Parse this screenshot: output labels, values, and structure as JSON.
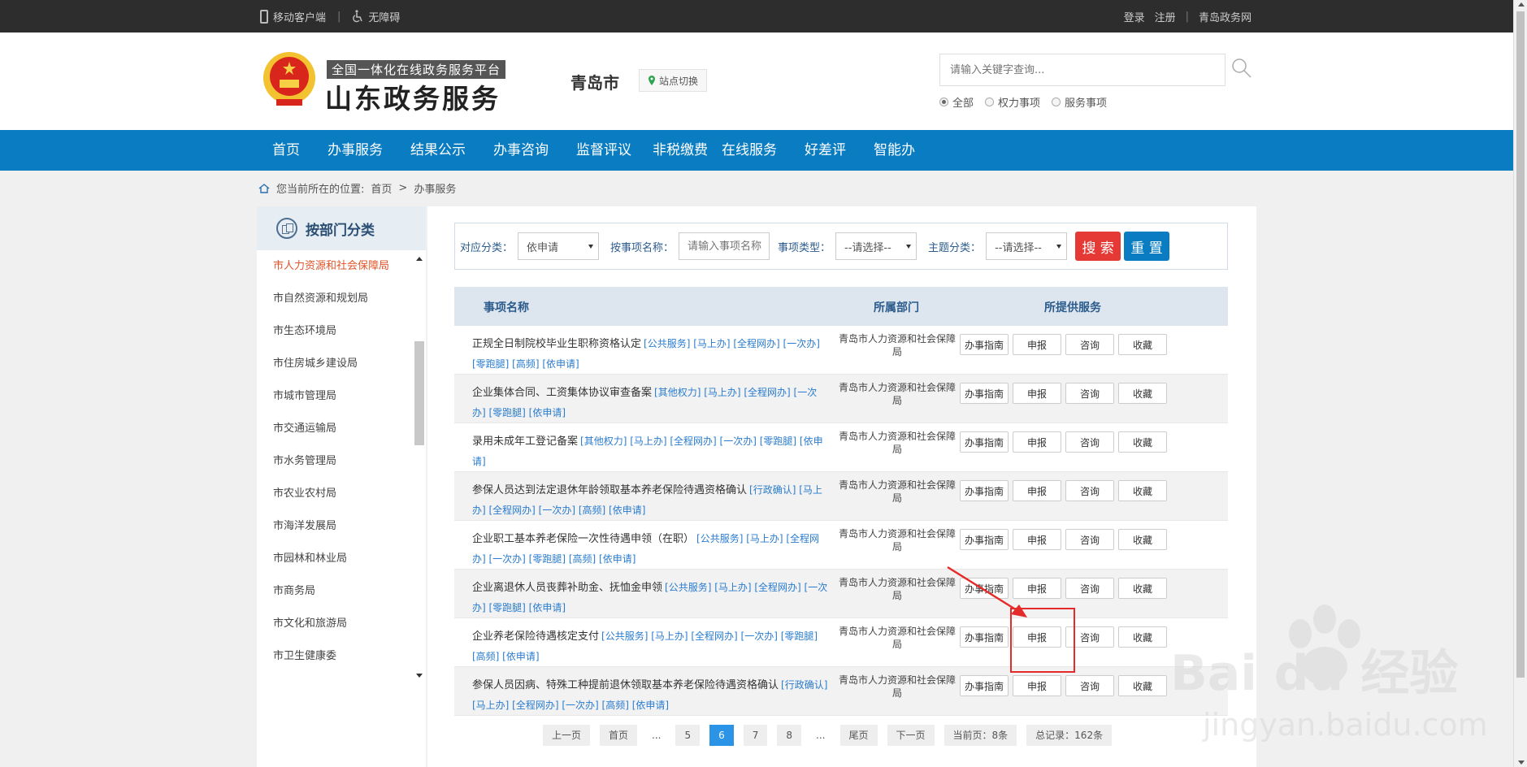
{
  "topbar": {
    "mobile_label": "移动客户端",
    "accessibility_label": "无障碍",
    "login_label": "登录",
    "register_label": "注册",
    "site_label": "青岛政务网"
  },
  "header": {
    "brand_sub": "全国一体化在线政务服务平台",
    "brand_main": "山东政务服务",
    "city": "青岛市",
    "site_switch": "站点切换",
    "search_placeholder": "请输入关键字查询...",
    "radio_all": "全部",
    "radio_power": "权力事项",
    "radio_service": "服务事项"
  },
  "nav": [
    "首页",
    "办事服务",
    "结果公示",
    "办事咨询",
    "监督评议",
    "非税缴费",
    "在线服务",
    "好差评",
    "智能办"
  ],
  "breadcrumb": {
    "prefix": "您当前所在的位置:",
    "home": "首页",
    "sep": ">",
    "current": "办事服务"
  },
  "sidebar": {
    "title": "按部门分类",
    "items": [
      "市人力资源和社会保障局",
      "市自然资源和规划局",
      "市生态环境局",
      "市住房城乡建设局",
      "市城市管理局",
      "市交通运输局",
      "市水务管理局",
      "市农业农村局",
      "市海洋发展局",
      "市园林和林业局",
      "市商务局",
      "市文化和旅游局",
      "市卫生健康委"
    ]
  },
  "filter": {
    "category_label": "对应分类：",
    "category_value": "依申请",
    "name_label": "按事项名称：",
    "name_placeholder": "请输入事项名称",
    "type_label": "事项类型：",
    "type_value": "--请选择--",
    "theme_label": "主题分类：",
    "theme_value": "--请选择--",
    "search_btn": "搜 索",
    "reset_btn": "重 置"
  },
  "table": {
    "headers": [
      "事项名称",
      "所属部门",
      "所提供服务"
    ],
    "actions": [
      "办事指南",
      "申报",
      "咨询",
      "收藏"
    ],
    "rows": [
      {
        "name": "正规全日制院校毕业生职称资格认定",
        "tags": "[公共服务] [马上办] [全程网办] [一次办] [零跑腿] [高频] [依申请]",
        "dept": "青岛市人力资源和社会保障局"
      },
      {
        "name": "企业集体合同、工资集体协议审查备案",
        "tags": "[其他权力] [马上办] [全程网办] [一次办] [零跑腿] [依申请]",
        "dept": "青岛市人力资源和社会保障局"
      },
      {
        "name": "录用未成年工登记备案",
        "tags": "[其他权力] [马上办] [全程网办] [一次办] [零跑腿] [依申请]",
        "dept": "青岛市人力资源和社会保障局"
      },
      {
        "name": "参保人员达到法定退休年龄领取基本养老保险待遇资格确认",
        "tags": "[行政确认] [马上办] [全程网办] [一次办] [高频] [依申请]",
        "dept": "青岛市人力资源和社会保障局"
      },
      {
        "name": "企业职工基本养老保险一次性待遇申领（在职）",
        "tags": "[公共服务] [马上办] [全程网办] [一次办] [零跑腿] [高频] [依申请]",
        "dept": "青岛市人力资源和社会保障局"
      },
      {
        "name": "企业离退休人员丧葬补助金、抚恤金申领",
        "tags": "[公共服务] [马上办] [全程网办] [一次办] [零跑腿] [依申请]",
        "dept": "青岛市人力资源和社会保障局"
      },
      {
        "name": "企业养老保险待遇核定支付",
        "tags": "[公共服务] [马上办] [全程网办] [一次办] [零跑腿] [高频] [依申请]",
        "dept": "青岛市人力资源和社会保障局"
      },
      {
        "name": "参保人员因病、特殊工种提前退休领取基本养老保险待遇资格确认",
        "tags": "[行政确认] [马上办] [全程网办] [一次办] [高频] [依申请]",
        "dept": "青岛市人力资源和社会保障局"
      }
    ]
  },
  "pager": {
    "prev": "上一页",
    "first": "首页",
    "ellipsis": "...",
    "pages": [
      "5",
      "6",
      "7",
      "8"
    ],
    "current": "6",
    "last": "尾页",
    "next": "下一页",
    "current_info": "当前页：8条",
    "total_info": "总记录：162条"
  },
  "watermark": {
    "line1": "Bai du 经验",
    "line2": "jingyan.baidu.com"
  },
  "colors": {
    "nav_blue": "#0a7cc1",
    "accent_red": "#e53935",
    "link_blue": "#2a7ccf",
    "active_orange": "#e0552a"
  }
}
